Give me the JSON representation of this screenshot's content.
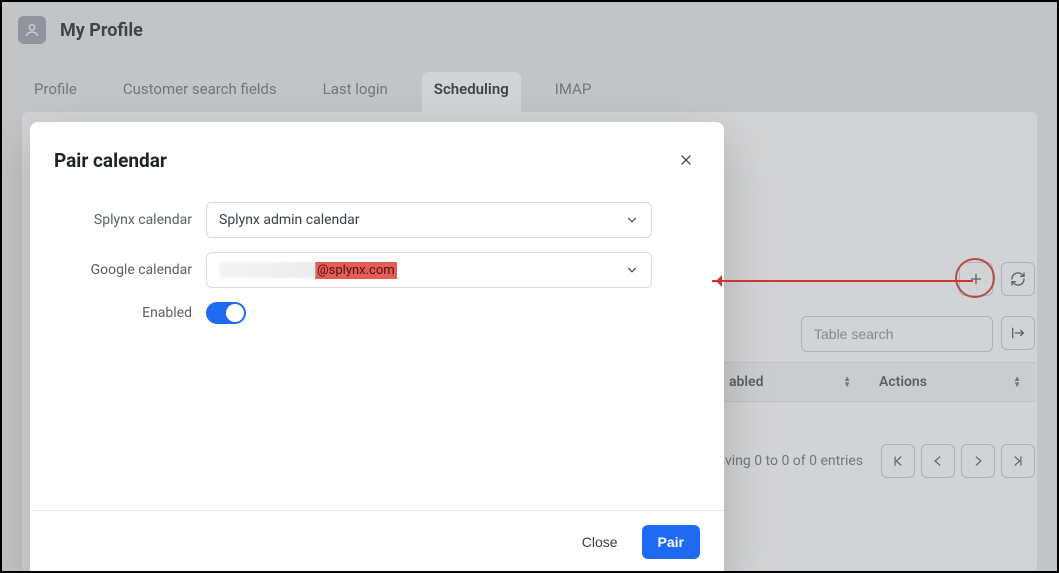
{
  "header": {
    "title": "My Profile"
  },
  "tabs": [
    {
      "id": "profile",
      "label": "Profile"
    },
    {
      "id": "csf",
      "label": "Customer search fields"
    },
    {
      "id": "last_login",
      "label": "Last login"
    },
    {
      "id": "scheduling",
      "label": "Scheduling",
      "active": true
    },
    {
      "id": "imap",
      "label": "IMAP"
    }
  ],
  "modal": {
    "title": "Pair calendar",
    "fields": {
      "splynx_calendar": {
        "label": "Splynx calendar",
        "value": "Splynx admin calendar"
      },
      "google_calendar": {
        "label": "Google calendar",
        "value_domain": "@splynx.com"
      },
      "enabled": {
        "label": "Enabled",
        "value": true
      }
    },
    "buttons": {
      "close": "Close",
      "pair": "Pair"
    }
  },
  "background": {
    "search_placeholder": "Table search",
    "columns": {
      "enabled": "abled",
      "actions": "Actions"
    },
    "pager_text": "ving 0 to 0 of 0 entries"
  },
  "colors": {
    "accent": "#1f6af2",
    "annotation": "#d0332d"
  }
}
